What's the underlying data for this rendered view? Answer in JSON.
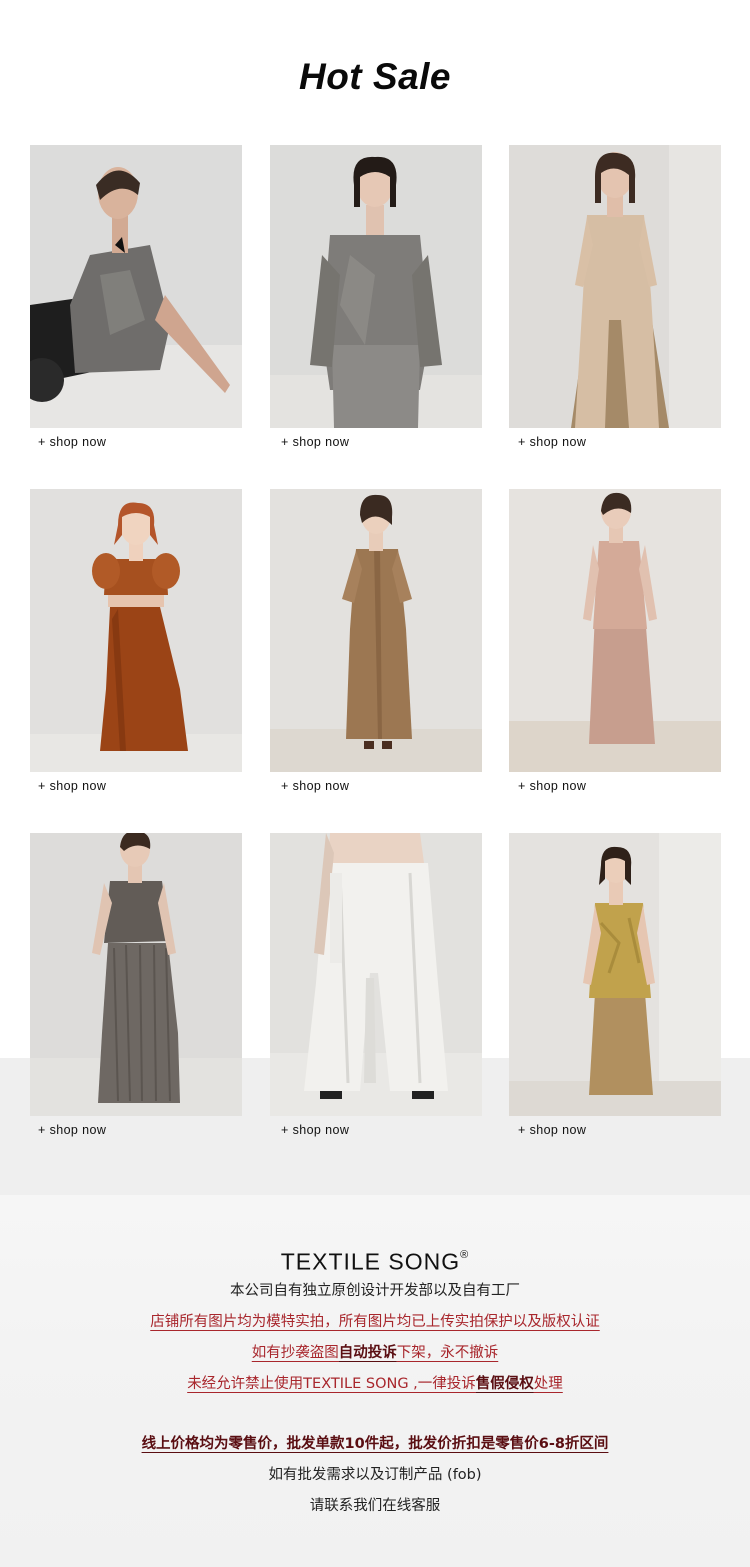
{
  "title": "Hot Sale",
  "products": [
    {
      "cta": "+ shop now",
      "look": "gray-tie-dye-cami-sitting"
    },
    {
      "cta": "+ shop now",
      "look": "gray-tie-dye-shirt-pants"
    },
    {
      "cta": "+ shop now",
      "look": "beige-knit-cardigan-camel-skirt"
    },
    {
      "cta": "+ shop now",
      "look": "rust-puff-sleeve-top-wide-pants"
    },
    {
      "cta": "+ shop now",
      "look": "camel-shirt-dress"
    },
    {
      "cta": "+ shop now",
      "look": "blush-halter-top-skirt"
    },
    {
      "cta": "+ shop now",
      "look": "gray-pleated-vest-skirt"
    },
    {
      "cta": "+ shop now",
      "look": "white-wide-pants"
    },
    {
      "cta": "+ shop now",
      "look": "yellow-jacquard-cami-camel-skirt"
    }
  ],
  "footer": {
    "brand": "TEXTILE SONG",
    "registered": "®",
    "line1": "本公司自有独立原创设计开发部以及自有工厂",
    "line2": "店铺所有图片均为模特实拍，所有图片均已上传实拍保护以及版权认证",
    "line3_a": "如有抄袭盗图",
    "line3_b": "自动投诉",
    "line3_c": "下架，永不撤诉",
    "line4_a": "未经允许禁止使用TEXTILE SONG ,一律投诉",
    "line4_b": "售假侵权",
    "line4_c": "处理",
    "line5": "线上价格均为零售价，批发单款10件起，批发价折扣是零售价6-8折区间",
    "line6": "如有批发需求以及订制产品 (fob)",
    "line7": "请联系我们在线客服"
  },
  "colors": {
    "accent_red": "#a8262c",
    "dark_red": "#5a0e12",
    "band_gray": "#efefef"
  }
}
